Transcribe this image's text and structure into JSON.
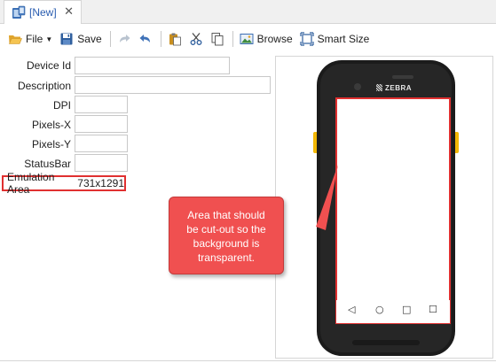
{
  "tab": {
    "label": "[New]",
    "close_glyph": "✕"
  },
  "toolbar": {
    "file_label": "File",
    "save_label": "Save",
    "browse_label": "Browse",
    "smart_size_label": "Smart Size"
  },
  "form": {
    "device_id": {
      "label": "Device Id",
      "value": ""
    },
    "description": {
      "label": "Description",
      "value": ""
    },
    "dpi": {
      "label": "DPI",
      "value": ""
    },
    "pixels_x": {
      "label": "Pixels-X",
      "value": ""
    },
    "pixels_y": {
      "label": "Pixels-Y",
      "value": ""
    },
    "statusbar": {
      "label": "StatusBar",
      "value": ""
    },
    "emulation_area": {
      "label": "Emulation Area",
      "value": "731x1291"
    }
  },
  "preview": {
    "brand": "ZEBRA",
    "nav_back": "◁",
    "nav_home": "○",
    "nav_recent": "□",
    "nav_menu": "☐"
  },
  "callout": {
    "lines": [
      "Area that should",
      "be cut-out so the",
      "background is",
      "transparent."
    ],
    "color": "#f05050"
  },
  "colors": {
    "highlight": "#e03030",
    "link": "#2a5db0"
  }
}
